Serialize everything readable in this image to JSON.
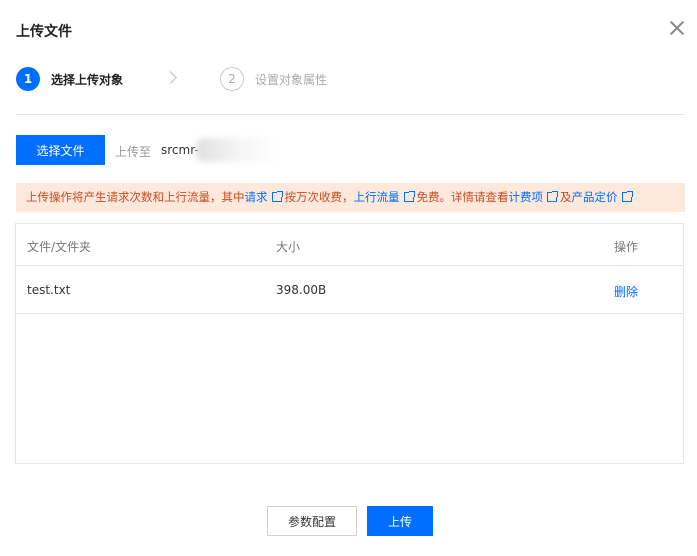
{
  "dialog": {
    "title": "上传文件",
    "close_icon": "close-icon"
  },
  "steps": [
    {
      "number": "1",
      "label": "选择上传对象",
      "state": "active"
    },
    {
      "number": "2",
      "label": "设置对象属性",
      "state": "pending"
    }
  ],
  "upload": {
    "select_button": "选择文件",
    "upload_to_label": "上传至",
    "bucket_prefix": "srcmr-"
  },
  "notice": {
    "t1": "上传操作将产生请求次数和上行流量，其中",
    "link_requests": "请求",
    "t2": "按万次收费，",
    "link_traffic": "上行流量",
    "t3": "免费。详情请查看",
    "link_billing": "计费项",
    "t4": "及",
    "link_pricing": "产品定价"
  },
  "table": {
    "headers": [
      "文件/文件夹",
      "大小",
      "操作"
    ],
    "rows": [
      {
        "name": "test.txt",
        "size": "398.00B",
        "action": "删除"
      }
    ]
  },
  "footer": {
    "params_button": "参数配置",
    "upload_button": "上传"
  },
  "colors": {
    "primary": "#006eff",
    "notice_bg": "#fde8dc",
    "notice_text": "#c84b22"
  }
}
